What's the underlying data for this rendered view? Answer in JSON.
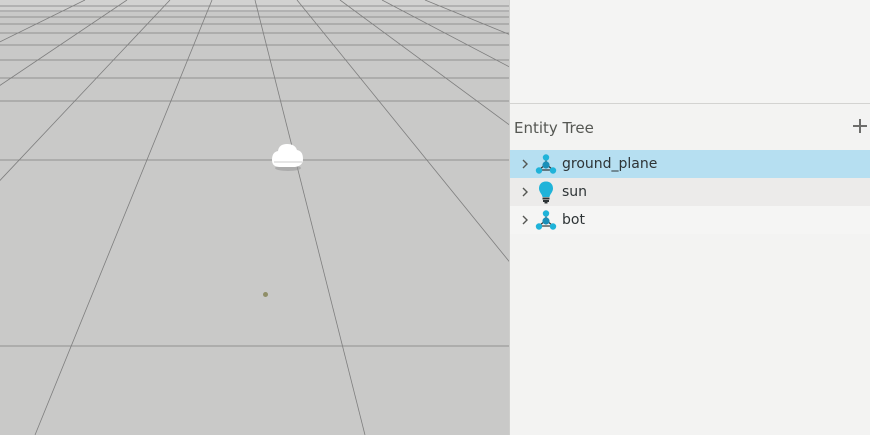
{
  "entity_tree": {
    "title": "Entity Tree",
    "add_icon": "plus-icon",
    "items": [
      {
        "label": "ground_plane",
        "icon": "model-icon",
        "selected": true
      },
      {
        "label": "sun",
        "icon": "light-bulb-icon",
        "selected": false
      },
      {
        "label": "bot",
        "icon": "model-icon",
        "selected": false
      }
    ]
  },
  "colors": {
    "selection": "#b6dff1",
    "icon_accent": "#1fb3d9",
    "ground": "#c9c9c8",
    "grid_line": "#7e7e7e"
  }
}
